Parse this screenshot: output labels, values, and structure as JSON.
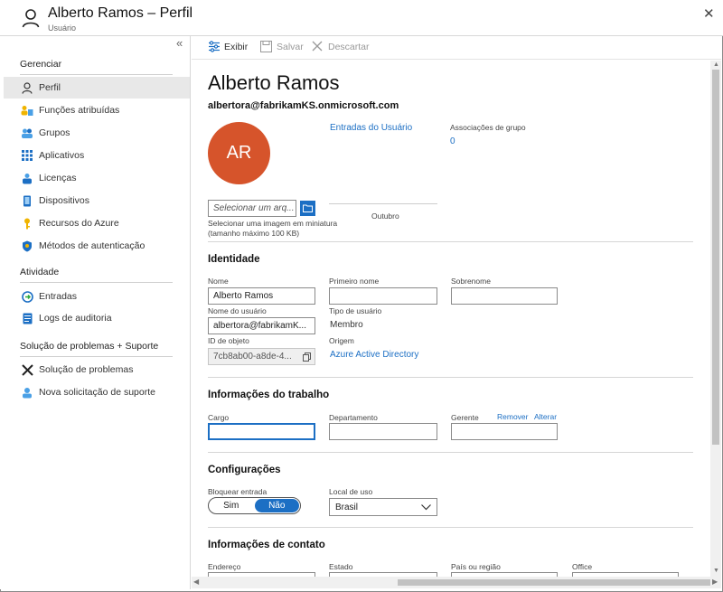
{
  "window": {
    "title": "Alberto Ramos – Perfil",
    "subtitle": "Usuário"
  },
  "sidebar": {
    "sections": [
      {
        "title": "Gerenciar",
        "items": [
          {
            "label": "Perfil",
            "icon": "person-icon",
            "active": true
          },
          {
            "label": "Funções atribuídas",
            "icon": "roles-icon"
          },
          {
            "label": "Grupos",
            "icon": "groups-icon"
          },
          {
            "label": "Aplicativos",
            "icon": "apps-grid-icon"
          },
          {
            "label": "Licenças",
            "icon": "license-icon"
          },
          {
            "label": "Dispositivos",
            "icon": "device-icon"
          },
          {
            "label": "Recursos do Azure",
            "icon": "key-icon"
          },
          {
            "label": "Métodos de autenticação",
            "icon": "shield-icon"
          }
        ]
      },
      {
        "title": "Atividade",
        "items": [
          {
            "label": "Entradas",
            "icon": "sign-in-icon"
          },
          {
            "label": "Logs de auditoria",
            "icon": "audit-log-icon"
          }
        ]
      },
      {
        "title": "Solução de problemas + Suporte",
        "items": [
          {
            "label": "Solução de problemas",
            "icon": "tools-icon"
          },
          {
            "label": "Nova solicitação de suporte",
            "icon": "support-icon"
          }
        ]
      }
    ]
  },
  "toolbar": {
    "edit_label": "Exibir",
    "save_label": "Salvar",
    "discard_label": "Descartar"
  },
  "profile": {
    "name": "Alberto Ramos",
    "email": "albertora@fabrikamKS.onmicrosoft.com",
    "initials": "AR",
    "file_placeholder": "Selecionar um arq...",
    "file_hint": "Selecionar uma imagem em miniatura (tamanho máximo 100 KB)",
    "signins_link": "Entradas do Usuário",
    "month_label": "Outubro",
    "group_assoc_label": "Associações de grupo",
    "group_assoc_value": "0"
  },
  "identity": {
    "section_title": "Identidade",
    "name_label": "Nome",
    "name_value": "Alberto Ramos",
    "first_name_label": "Primeiro nome",
    "first_name_value": "",
    "last_name_label": "Sobrenome",
    "last_name_value": "",
    "username_label": "Nome do usuário",
    "username_value": "albertora@fabrikamK...",
    "user_type_label": "Tipo de usuário",
    "user_type_value": "Membro",
    "object_id_label": "ID de objeto",
    "object_id_value": "7cb8ab00-a8de-4...",
    "source_label": "Origem",
    "source_value": "Azure Active Directory"
  },
  "job": {
    "section_title": "Informações do trabalho",
    "title_label": "Cargo",
    "title_value": "",
    "department_label": "Departamento",
    "department_value": "",
    "manager_label": "Gerente",
    "manager_remove": "Remover",
    "manager_change": "Alterar",
    "manager_value": ""
  },
  "settings": {
    "section_title": "Configurações",
    "block_label": "Bloquear entrada",
    "block_yes": "Sim",
    "block_no": "Não",
    "block_selected": "Não",
    "usage_location_label": "Local de uso",
    "usage_location_value": "Brasil"
  },
  "contact": {
    "section_title": "Informações de contato",
    "address_label": "Endereço",
    "state_label": "Estado",
    "country_label": "País ou região",
    "office_label": "Office"
  },
  "colors": {
    "accent": "#1c6fc4",
    "avatar": "#d6542b"
  }
}
